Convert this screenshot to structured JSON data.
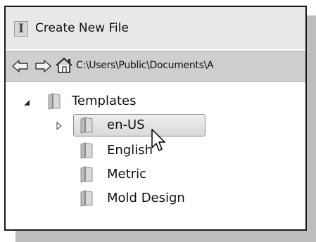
{
  "window": {
    "title": "Create New File",
    "app_icon_glyph": "I"
  },
  "address_bar": {
    "path": "C:\\Users\\Public\\Documents\\A",
    "back_icon": "back-arrow-icon",
    "forward_icon": "forward-arrow-icon",
    "home_icon": "home-icon"
  },
  "tree": {
    "root": {
      "label": "Templates",
      "expanded": true
    },
    "children": [
      {
        "label": "en-US",
        "selected": true,
        "has_children": true
      },
      {
        "label": "English",
        "selected": false,
        "has_children": false
      },
      {
        "label": "Metric",
        "selected": false,
        "has_children": false
      },
      {
        "label": "Mold Design",
        "selected": false,
        "has_children": false
      }
    ]
  },
  "colors": {
    "titlebar": "#e8e8e8",
    "addressbar": "#cfcfcf",
    "selection": "#e2e2e2",
    "shadow": "#bdbdbd"
  }
}
